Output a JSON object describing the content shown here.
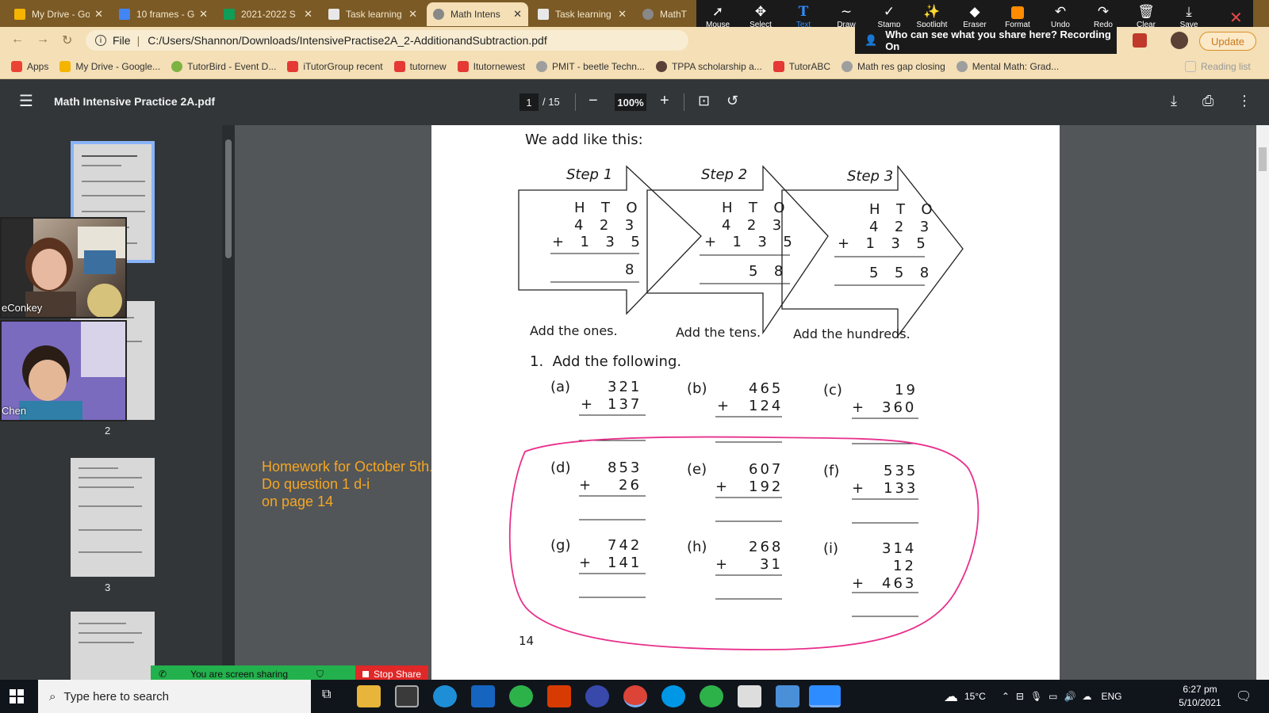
{
  "tabs": [
    {
      "title": "My Drive - Go",
      "favicon_color": "#f4b400",
      "active": false
    },
    {
      "title": "10 frames - G",
      "favicon_color": "#4285f4",
      "active": false
    },
    {
      "title": "2021-2022 S",
      "favicon_color": "#0f9d58",
      "active": false
    },
    {
      "title": "Task learning",
      "favicon_color": "#e8e8e8",
      "active": false
    },
    {
      "title": "Math Intens",
      "favicon_color": "#888888",
      "active": true
    },
    {
      "title": "Task learning",
      "favicon_color": "#e8e8e8",
      "active": false
    },
    {
      "title": "MathT",
      "favicon_color": "#888888",
      "active": false
    }
  ],
  "annotation_toolbar": {
    "tools": [
      {
        "label": "Mouse",
        "icon": "cursor-icon"
      },
      {
        "label": "Select",
        "icon": "move-icon"
      },
      {
        "label": "Text",
        "icon": "text-icon",
        "selected": true
      },
      {
        "label": "Draw",
        "icon": "squiggle-icon"
      },
      {
        "label": "Stamp",
        "icon": "checkmark-icon"
      },
      {
        "label": "Spotlight",
        "icon": "wand-icon"
      },
      {
        "label": "Eraser",
        "icon": "eraser-icon"
      },
      {
        "label": "Format",
        "icon": "format-swatch-icon"
      },
      {
        "label": "Undo",
        "icon": "undo-icon"
      },
      {
        "label": "Redo",
        "icon": "redo-icon"
      },
      {
        "label": "Clear",
        "icon": "trash-icon"
      },
      {
        "label": "Save",
        "icon": "save-icon"
      }
    ]
  },
  "address_bar": {
    "scheme_label": "File",
    "url": "C:/Users/Shannon/Downloads/IntensivePractise2A_2-AdditionandSubtraction.pdf",
    "share_notice": "Who can see what you share here? Recording On",
    "update_label": "Update"
  },
  "bookmarks": [
    {
      "label": "Apps",
      "color": "#ea4335"
    },
    {
      "label": "My Drive - Google...",
      "color": "#f4b400"
    },
    {
      "label": "TutorBird - Event D...",
      "color": "#7cb342"
    },
    {
      "label": "iTutorGroup recent",
      "color": "#e53935"
    },
    {
      "label": "tutornew",
      "color": "#e53935"
    },
    {
      "label": "Itutornewest",
      "color": "#e53935"
    },
    {
      "label": "PMIT - beetle Techn...",
      "color": "#9e9e9e"
    },
    {
      "label": "TPPA scholarship a...",
      "color": "#5d4037"
    },
    {
      "label": "TutorABC",
      "color": "#e53935"
    },
    {
      "label": "Math res gap closing",
      "color": "#9e9e9e"
    },
    {
      "label": "Mental Math: Grad...",
      "color": "#9e9e9e"
    }
  ],
  "bookmarks_reading_list": "Reading list",
  "pdf_toolbar": {
    "title": "Math Intensive Practice 2A.pdf",
    "current_page": "1",
    "total_pages": "/ 15",
    "zoom": "100%"
  },
  "sidebar": {
    "page_numbers": [
      "2",
      "3"
    ]
  },
  "pdf_page": {
    "intro": "We add like this:",
    "steps": [
      {
        "title": "Step 1",
        "headers": "H  T  O",
        "top": "4  2  3",
        "bottom": "+  1  3  5",
        "result": "8",
        "caption": "Add the ones."
      },
      {
        "title": "Step 2",
        "headers": "H  T  O",
        "top": "4  2  3",
        "bottom": "+  1  3  5",
        "result": "5  8",
        "caption": "Add the tens."
      },
      {
        "title": "Step 3",
        "headers": "H  T  O",
        "top": "4  2  3",
        "bottom": "+  1  3  5",
        "result": "5  5  8",
        "caption": "Add the hundreds."
      }
    ],
    "question": "1.  Add the following.",
    "problems": [
      {
        "label": "(a)",
        "lines": [
          "321",
          "137"
        ]
      },
      {
        "label": "(b)",
        "lines": [
          "465",
          "124"
        ]
      },
      {
        "label": "(c)",
        "lines": [
          "19",
          "360"
        ]
      },
      {
        "label": "(d)",
        "lines": [
          "853",
          "26"
        ]
      },
      {
        "label": "(e)",
        "lines": [
          "607",
          "192"
        ]
      },
      {
        "label": "(f)",
        "lines": [
          "535",
          "133"
        ]
      },
      {
        "label": "(g)",
        "lines": [
          "742",
          "141"
        ]
      },
      {
        "label": "(h)",
        "lines": [
          "268",
          "31"
        ]
      },
      {
        "label": "(i)",
        "lines": [
          "314",
          "12",
          "463"
        ]
      }
    ],
    "plus_sign": "+",
    "page_number": "14",
    "circle_color": "#e8308c"
  },
  "homework_note": {
    "line1": "Homework for October 5th.",
    "line2": "Do question 1 d-i",
    "line3": "on page 14",
    "color": "#f5a623"
  },
  "video_tiles": [
    {
      "name": "eConkey"
    },
    {
      "name": "Chen"
    }
  ],
  "share_bar": {
    "status": "You are screen sharing",
    "stop_label": "Stop Share"
  },
  "taskbar": {
    "search_placeholder": "Type here to search",
    "weather": "15°C",
    "language": "ENG",
    "time": "6:27 pm",
    "date": "5/10/2021"
  }
}
